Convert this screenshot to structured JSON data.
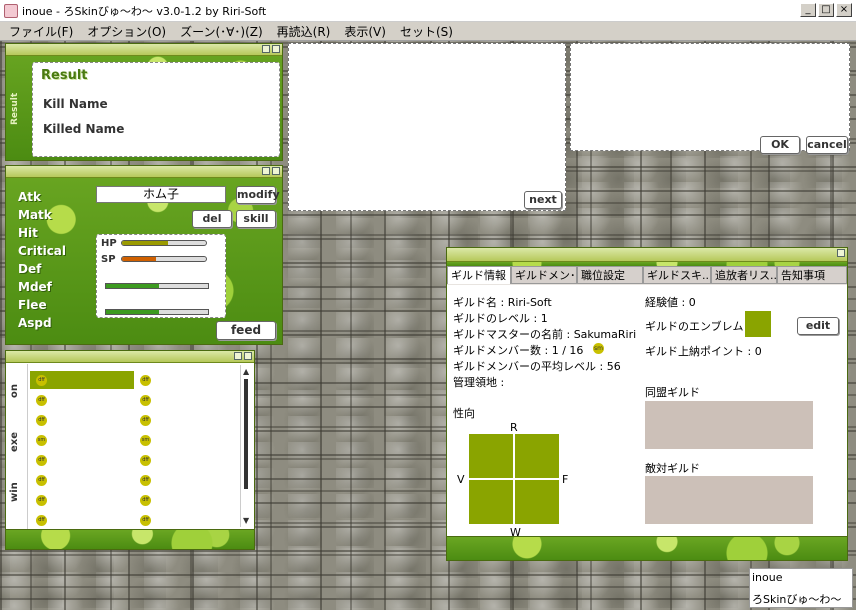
{
  "window": {
    "title": "inoue - ろSkinびゅ〜わ〜 v3.0-1.2 by Riri-Soft",
    "minimize": "_",
    "maximize": "□",
    "close": "×"
  },
  "menu": [
    "ファイル(F)",
    "オプション(O)",
    "ズーン(･∀･)(Z)",
    "再読込(R)",
    "表示(V)",
    "セット(S)"
  ],
  "result_panel": {
    "side_label": "Result",
    "title": "Result",
    "kill_name": "Kill Name",
    "killed_name": "Killed Name"
  },
  "status_panel": {
    "stats": [
      "Atk",
      "Matk",
      "Hit",
      "Critical",
      "Def",
      "Mdef",
      "Flee",
      "Aspd"
    ],
    "name_value": "ホム子",
    "buttons": {
      "modify": "modify",
      "del": "del",
      "skill": "skill",
      "feed": "feed"
    },
    "hp_label": "HP",
    "sp_label": "SP",
    "hp_fraction": 0.55,
    "sp_fraction": 0.4,
    "bar3_fraction": 0.52,
    "bar4_fraction": 0.52,
    "colors": {
      "hp": "#9a9a00",
      "sp": "#d06000",
      "bar": "#3c9a20"
    }
  },
  "chat_panel": {
    "tabs": [
      "on",
      "exe",
      "win"
    ],
    "next_label": "next"
  },
  "dialog_panel": {
    "ok": "OK",
    "cancel": "cancel"
  },
  "list_panel": {
    "icon_left": [
      "dff",
      "dff",
      "dff",
      "sm",
      "dff",
      "dff",
      "dff",
      "dff"
    ],
    "icon_right": [
      "dff",
      "dff",
      "dff",
      "sm",
      "dff",
      "dff",
      "dff",
      "dff"
    ]
  },
  "guild": {
    "tabs": [
      "ギルド情報",
      "ギルドメン･..",
      "職位設定",
      "ギルドスキ..",
      "追放者リス..",
      "告知事項"
    ],
    "name": "ギルド名 : Riri-Soft",
    "level": "ギルドのレベル : 1",
    "master": "ギルドマスターの名前 : SakumaRiri",
    "members": "ギルドメンバー数 : 1 / 16",
    "avg_level": "ギルドメンバーの平均レベル : 56",
    "territory": "管理領地 :",
    "exp": "経験値 : 0",
    "emblem": "ギルドのエンブレム",
    "edit": "edit",
    "tax_points": "ギルド上納ポイント : 0",
    "tendency": "性向",
    "axis": {
      "top": "R",
      "bottom": "W",
      "left": "V",
      "right": "F"
    },
    "allied": "同盟ギルド",
    "hostile": "敵対ギルド",
    "colors": {
      "emblem": "#8aa400",
      "grid": "#8aa400",
      "guildbox": "#ccc0b8"
    }
  },
  "statusbar": {
    "line1": "inoue",
    "line2": "ろSkinびゅ〜わ〜"
  }
}
